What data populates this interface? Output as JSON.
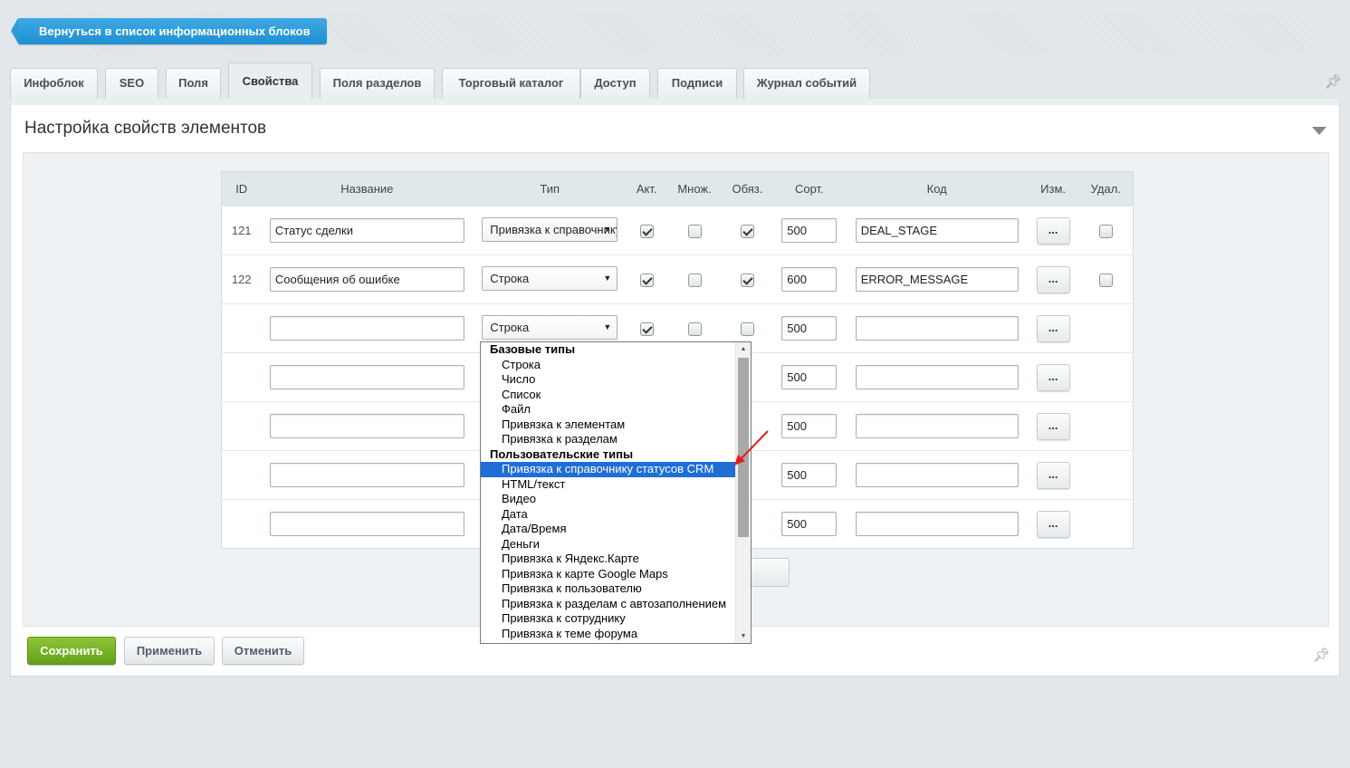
{
  "back_button": "Вернуться в список информационных блоков",
  "tabs": [
    {
      "label": "Инфоблок"
    },
    {
      "label": "SEO"
    },
    {
      "label": "Поля"
    },
    {
      "label": "Свойства",
      "active": true
    },
    {
      "label": "Поля разделов"
    },
    {
      "label": "Торговый каталог"
    },
    {
      "label": "Доступ"
    },
    {
      "label": "Подписи"
    },
    {
      "label": "Журнал событий"
    }
  ],
  "panel": {
    "title": "Настройка свойств элементов"
  },
  "table": {
    "headers": {
      "id": "ID",
      "name": "Название",
      "type": "Тип",
      "active": "Акт.",
      "multiple": "Множ.",
      "required": "Обяз.",
      "sort": "Сорт.",
      "code": "Код",
      "edit": "Изм.",
      "delete": "Удал."
    },
    "rows": [
      {
        "id": "121",
        "name": "Статус сделки",
        "type": "Привязка к справочнику статусов CRM",
        "active": true,
        "multiple": false,
        "required": true,
        "sort": "500",
        "code": "DEAL_STAGE",
        "edit": "...",
        "has_delete": true
      },
      {
        "id": "122",
        "name": "Сообщения об ошибке",
        "type": "Строка",
        "active": true,
        "multiple": false,
        "required": true,
        "sort": "600",
        "code": "ERROR_MESSAGE",
        "edit": "...",
        "has_delete": true
      },
      {
        "id": "",
        "name": "",
        "type": "Строка",
        "active": true,
        "multiple": false,
        "required": false,
        "sort": "500",
        "code": "",
        "edit": "...",
        "has_delete": false
      },
      {
        "id": "",
        "name": "",
        "type": "",
        "sort": "500",
        "code": "",
        "edit": "...",
        "has_delete": false
      },
      {
        "id": "",
        "name": "",
        "type": "",
        "sort": "500",
        "code": "",
        "edit": "...",
        "has_delete": false
      },
      {
        "id": "",
        "name": "",
        "type": "",
        "sort": "500",
        "code": "",
        "edit": "...",
        "has_delete": false
      },
      {
        "id": "",
        "name": "",
        "type": "",
        "sort": "500",
        "code": "",
        "edit": "...",
        "has_delete": false
      }
    ]
  },
  "type_dropdown": {
    "groups": [
      {
        "label": "Базовые типы",
        "options": [
          "Строка",
          "Число",
          "Список",
          "Файл",
          "Привязка к элементам",
          "Привязка к разделам"
        ]
      },
      {
        "label": "Пользовательские типы",
        "options": [
          "Привязка к справочнику статусов CRM",
          "HTML/текст",
          "Видео",
          "Дата",
          "Дата/Время",
          "Деньги",
          "Привязка к Яндекс.Карте",
          "Привязка к карте Google Maps",
          "Привязка к пользователю",
          "Привязка к разделам с автозаполнением",
          "Привязка к сотруднику",
          "Привязка к теме форума"
        ]
      }
    ],
    "highlighted": "Привязка к справочнику статусов CRM"
  },
  "footer": {
    "save": "Сохранить",
    "apply": "Применить",
    "cancel": "Отменить"
  },
  "colors": {
    "accent": "#1e8fd3",
    "save": "#63a116",
    "highlight": "#1e6ed6",
    "annotation_arrow": "#e0201b"
  }
}
